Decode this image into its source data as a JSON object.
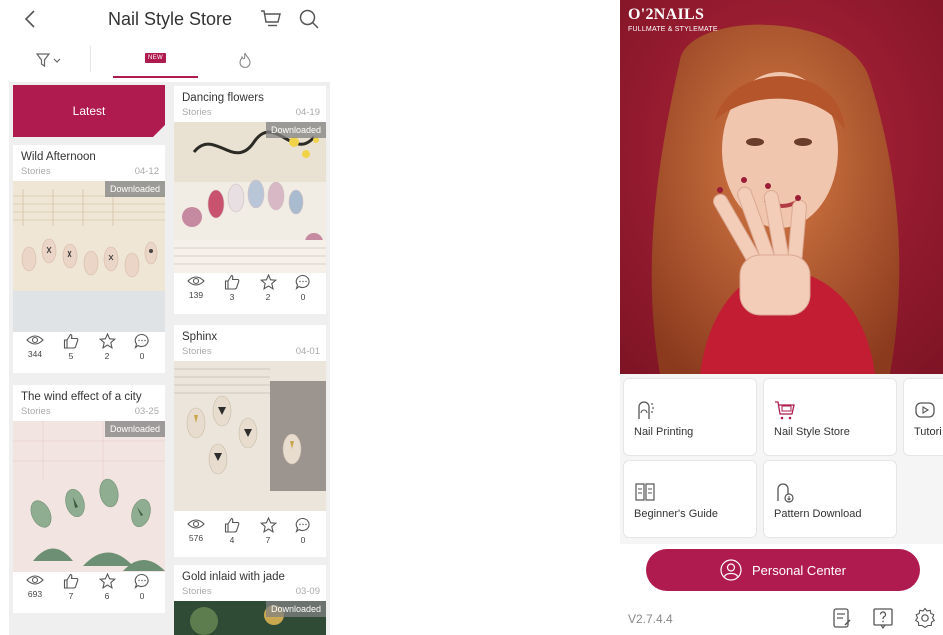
{
  "store": {
    "title": "Nail Style Store",
    "latest_label": "Latest",
    "new_badge": "NEW",
    "accent": "#b01b4f",
    "cards": [
      {
        "title": "Wild Afternoon",
        "category": "Stories",
        "date": "04-12",
        "downloaded": "Downloaded",
        "views": "344",
        "likes": "5",
        "favorites": "2",
        "comments": "0"
      },
      {
        "title": "The wind effect of a city",
        "category": "Stories",
        "date": "03-25",
        "downloaded": "Downloaded",
        "views": "693",
        "likes": "7",
        "favorites": "6",
        "comments": "0"
      },
      {
        "title": "Dancing flowers",
        "category": "Stories",
        "date": "04-19",
        "downloaded": "Downloaded",
        "views": "139",
        "likes": "3",
        "favorites": "2",
        "comments": "0"
      },
      {
        "title": "Sphinx",
        "category": "Stories",
        "date": "04-01",
        "downloaded": "",
        "views": "576",
        "likes": "4",
        "favorites": "7",
        "comments": "0"
      },
      {
        "title": "Gold inlaid with jade",
        "category": "Stories",
        "date": "03-09",
        "downloaded": "Downloaded"
      }
    ]
  },
  "home": {
    "brand": "O'2NAILS",
    "brand_sub": "FULLMATE & STYLEMATE",
    "tiles": [
      {
        "label": "Nail Printing",
        "icon": "nail-printing-icon"
      },
      {
        "label": "Nail Style Store",
        "icon": "store-cart-icon"
      },
      {
        "label": "Tutori",
        "icon": "play-icon"
      },
      {
        "label": "Beginner's Guide",
        "icon": "book-icon"
      },
      {
        "label": "Pattern Download",
        "icon": "pattern-download-icon"
      }
    ],
    "personal_center": "Personal Center",
    "version": "V2.7.4.4"
  }
}
